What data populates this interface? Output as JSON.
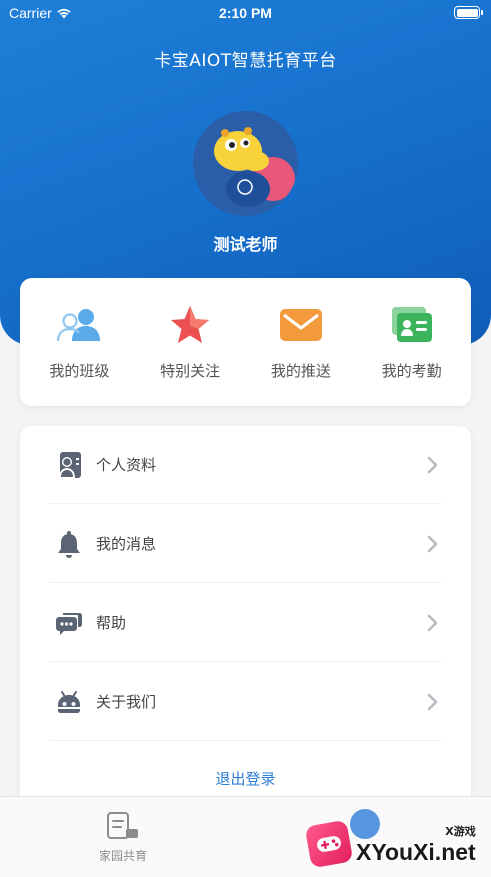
{
  "status_bar": {
    "carrier": "Carrier",
    "time": "2:10 PM"
  },
  "header": {
    "app_title": "卡宝AIOT智慧托育平台",
    "user_name": "测试老师"
  },
  "quick_actions": [
    {
      "label": "我的班级",
      "icon": "users-icon",
      "color": "#5aa9e8"
    },
    {
      "label": "特别关注",
      "icon": "star-icon",
      "color": "#e84a4a"
    },
    {
      "label": "我的推送",
      "icon": "mail-icon",
      "color": "#f08a32"
    },
    {
      "label": "我的考勤",
      "icon": "id-card-icon",
      "color": "#3cb45c"
    }
  ],
  "menu": {
    "items": [
      {
        "label": "个人资料",
        "icon": "profile-icon"
      },
      {
        "label": "我的消息",
        "icon": "bell-icon"
      },
      {
        "label": "帮助",
        "icon": "chat-icon"
      },
      {
        "label": "关于我们",
        "icon": "robot-icon"
      }
    ],
    "logout_label": "退出登录"
  },
  "tabbar": {
    "items": [
      {
        "label": "家园共育",
        "icon": "document-icon"
      }
    ]
  },
  "watermark": {
    "small": "X游戏",
    "big": "XYouXi.net"
  },
  "colors": {
    "header_blue": "#1670cc",
    "accent_blue": "#2d7fd6",
    "background": "#f3f4f6"
  }
}
